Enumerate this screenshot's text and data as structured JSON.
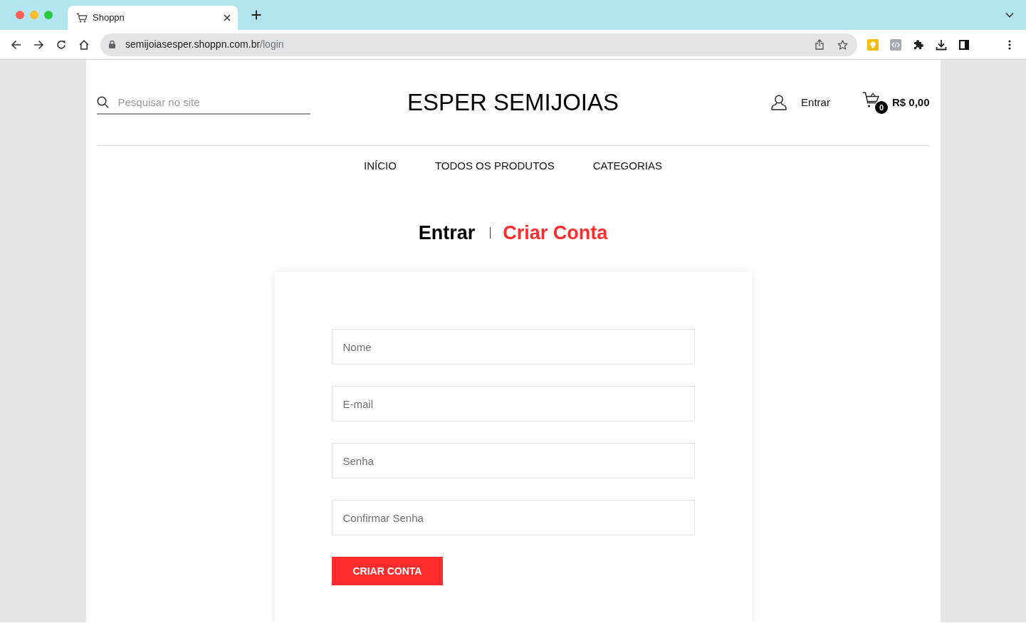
{
  "browser": {
    "tab": {
      "title": "Shoppn"
    },
    "address_bar": {
      "host": "semijoiasesper.shoppn.com.br",
      "path": "/login"
    }
  },
  "header": {
    "search": {
      "placeholder": "Pesquisar no site"
    },
    "logo": "ESPER SEMIJOIAS",
    "account_link": "Entrar",
    "cart": {
      "count": "0",
      "total": "R$ 0,00"
    }
  },
  "nav": [
    "INÍCIO",
    "TODOS OS PRODUTOS",
    "CATEGORIAS"
  ],
  "auth_tabs": [
    {
      "label": "Entrar",
      "selected": false
    },
    {
      "label": "Criar Conta",
      "selected": true
    }
  ],
  "signup_form": {
    "fields": [
      {
        "placeholder": "Nome"
      },
      {
        "placeholder": "E-mail"
      },
      {
        "placeholder": "Senha"
      },
      {
        "placeholder": "Confirmar Senha"
      }
    ],
    "submit_button": "CRIAR CONTA"
  }
}
